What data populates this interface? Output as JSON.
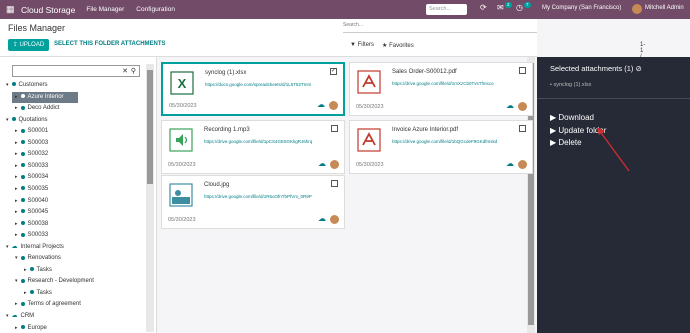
{
  "topbar": {
    "app_name": "Cloud Storage",
    "menu_file_manager": "File Manager",
    "menu_configuration": "Configuration",
    "search_placeholder": "Search...",
    "badge_chat": "2",
    "badge_activity": "7",
    "company": "My Company (San Francisco)",
    "user": "Mitchell Admin"
  },
  "control": {
    "title": "Files Manager",
    "upload_label": "UPLOAD",
    "select_all_label": "SELECT THIS FOLDER ATTACHMENTS",
    "search_placeholder": "Search...",
    "filters_label": "Filters",
    "favorites_label": "Favorites",
    "pager": "1-1 / 5"
  },
  "tree": [
    {
      "label": "Customers",
      "level": 0
    },
    {
      "label": "Azure Interior",
      "level": 1,
      "active": true
    },
    {
      "label": "Deco Addict",
      "level": 1
    },
    {
      "label": "Quotations",
      "level": 0
    },
    {
      "label": "S00001",
      "level": 1
    },
    {
      "label": "S00003",
      "level": 1
    },
    {
      "label": "S00032",
      "level": 1
    },
    {
      "label": "S00033",
      "level": 1
    },
    {
      "label": "S00034",
      "level": 1
    },
    {
      "label": "S00035",
      "level": 1
    },
    {
      "label": "S00040",
      "level": 1
    },
    {
      "label": "S00045",
      "level": 1
    },
    {
      "label": "S00038",
      "level": 1
    },
    {
      "label": "S00033",
      "level": 1
    },
    {
      "label": "Internal Projects",
      "level": 0
    },
    {
      "label": "Renovations",
      "level": 1
    },
    {
      "label": "Tasks",
      "level": 2
    },
    {
      "label": "Research - Development",
      "level": 1
    },
    {
      "label": "Tasks",
      "level": 2
    },
    {
      "label": "Terms of agreement",
      "level": 1
    },
    {
      "label": "CRM",
      "level": 0
    },
    {
      "label": "Europe",
      "level": 1
    }
  ],
  "cards": [
    {
      "name": "synclog (1).xlsx",
      "url": "https://docs.google.com/spreadsheets/d/1L5T82Tmm",
      "date": "05/30/2023",
      "type": "excel",
      "checked": true
    },
    {
      "name": "Sales Order-S00012.pdf",
      "url": "https://drive.google.com/file/d/1mXzCb0TvsTfmsco",
      "date": "05/30/2023",
      "type": "pdf",
      "checked": false
    },
    {
      "name": "Recording 1.mp3",
      "url": "https://drive.google.com/file/d/1pCS4GE5GKkgRJ6hrq",
      "date": "05/30/2023",
      "type": "audio",
      "checked": false
    },
    {
      "name": "Invoice Azure Interior.pdf",
      "url": "https://drive.google.com/file/d/1bQGcdeF9GKdfmskd",
      "date": "05/30/2023",
      "type": "pdf",
      "checked": false
    },
    {
      "name": "Cloud.jpg",
      "url": "https://drive.google.com/file/d/1R6oOfnTbPfVm_0R9P",
      "date": "05/30/2023",
      "type": "image",
      "checked": false
    }
  ],
  "right": {
    "title": "Selected attachments (1)",
    "file": "synclog (1).xlsx",
    "actions": [
      "Download",
      "Update folder",
      "Delete"
    ]
  },
  "colors": {
    "brand": "#714b67",
    "accent": "#00a09d",
    "panel_dark": "#262a36",
    "annotation_arrow": "#d02c2c"
  }
}
